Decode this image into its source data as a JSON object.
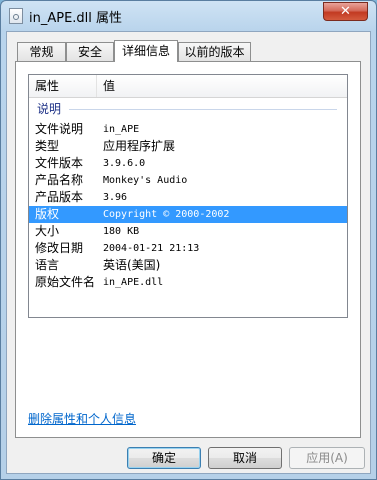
{
  "window": {
    "title": "in_APE.dll 属性",
    "close_label": "✕"
  },
  "tabs": [
    {
      "label": "常规",
      "active": false
    },
    {
      "label": "安全",
      "active": false
    },
    {
      "label": "详细信息",
      "active": true
    },
    {
      "label": "以前的版本",
      "active": false
    }
  ],
  "details": {
    "col_property": "属性",
    "col_value": "值",
    "group_label": "说明",
    "rows": [
      {
        "property": "文件说明",
        "value": "in_APE",
        "selected": false
      },
      {
        "property": "类型",
        "value": "应用程序扩展",
        "selected": false
      },
      {
        "property": "文件版本",
        "value": "3.9.6.0",
        "selected": false
      },
      {
        "property": "产品名称",
        "value": "Monkey's Audio",
        "selected": false
      },
      {
        "property": "产品版本",
        "value": "3.96",
        "selected": false
      },
      {
        "property": "版权",
        "value": "Copyright © 2000-2002",
        "selected": true
      },
      {
        "property": "大小",
        "value": "180 KB",
        "selected": false
      },
      {
        "property": "修改日期",
        "value": "2004-01-21 21:13",
        "selected": false
      },
      {
        "property": "语言",
        "value": "英语(美国)",
        "selected": false
      },
      {
        "property": "原始文件名",
        "value": "in_APE.dll",
        "selected": false
      }
    ]
  },
  "links": {
    "remove_properties": "删除属性和个人信息"
  },
  "buttons": {
    "ok": "确定",
    "cancel": "取消",
    "apply": "应用(A)"
  },
  "colors": {
    "selection": "#3399ff",
    "link": "#0066cc",
    "group_header": "#1e3287"
  }
}
